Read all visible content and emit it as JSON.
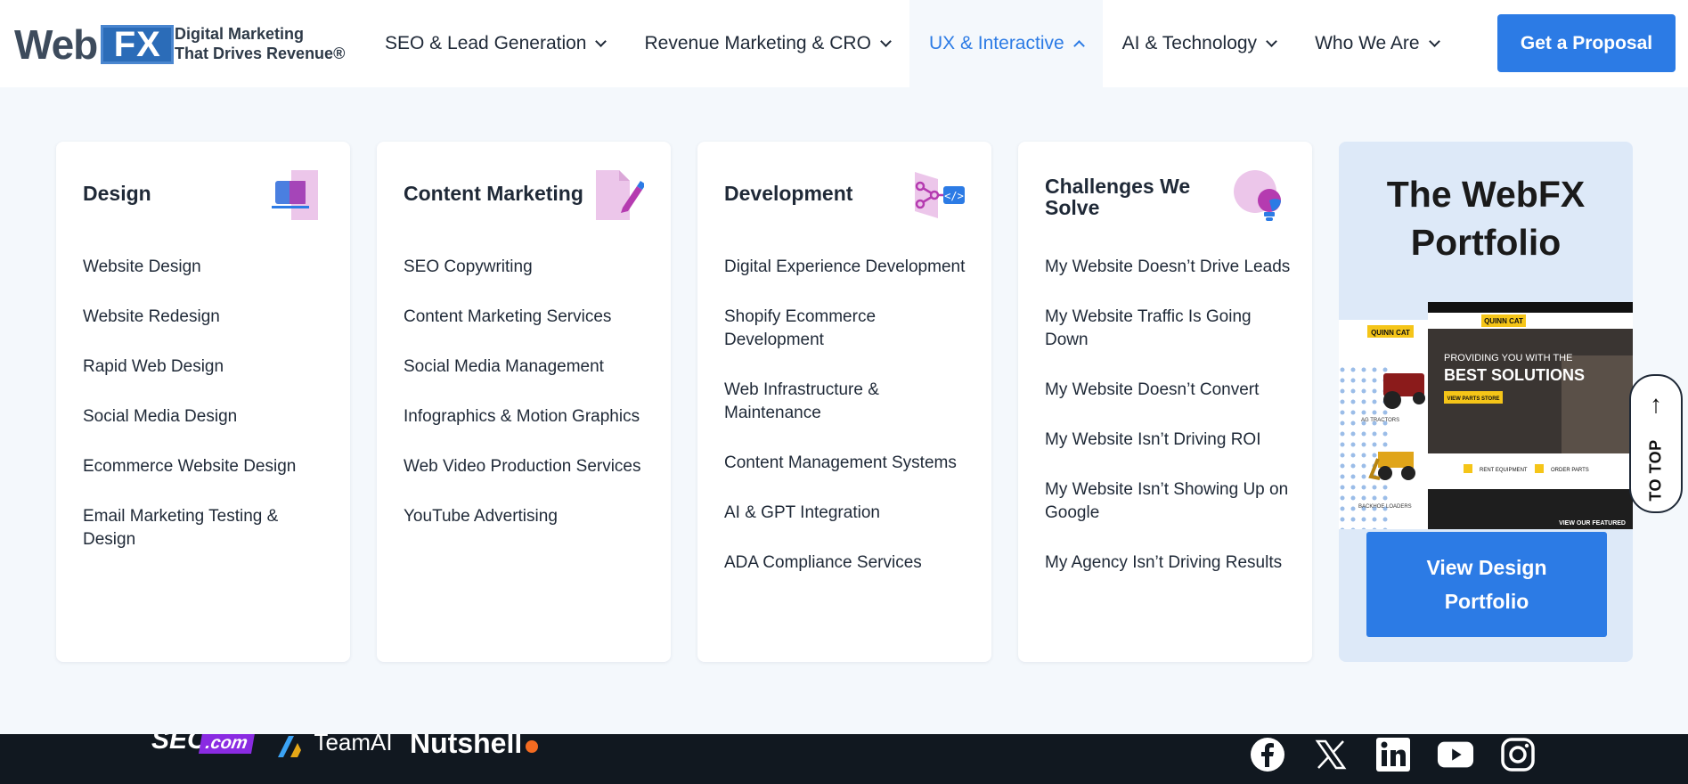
{
  "brand": {
    "logo_web": "Web",
    "logo_fx": "FX",
    "tagline_line1": "Digital Marketing",
    "tagline_line2": "That Drives Revenue®"
  },
  "nav": {
    "items": [
      {
        "label": "SEO & Lead Generation",
        "active": false
      },
      {
        "label": "Revenue Marketing & CRO",
        "active": false
      },
      {
        "label": "UX & Interactive",
        "active": true
      },
      {
        "label": "AI & Technology",
        "active": false
      },
      {
        "label": "Who We Are",
        "active": false
      }
    ],
    "cta_label": "Get a Proposal"
  },
  "menu": {
    "columns": [
      {
        "title": "Design",
        "icon": "laptop-icon",
        "links": [
          "Website Design",
          "Website Redesign",
          "Rapid Web Design",
          "Social Media Design",
          "Ecommerce Website Design",
          "Email Marketing Testing & Design"
        ]
      },
      {
        "title": "Content Marketing",
        "icon": "document-pen-icon",
        "links": [
          "SEO Copywriting",
          "Content Marketing Services",
          "Social Media Management",
          "Infographics & Motion Graphics",
          "Web Video Production Services",
          "YouTube Advertising"
        ]
      },
      {
        "title": "Development",
        "icon": "code-network-icon",
        "links": [
          "Digital Experience Development",
          "Shopify Ecommerce Development",
          "Web Infrastructure & Maintenance",
          "Content Management Systems",
          "AI & GPT Integration",
          "ADA Compliance Services"
        ]
      },
      {
        "title": "Challenges We Solve",
        "icon": "lightbulb-icon",
        "links": [
          "My Website Doesn’t Drive Leads",
          "My Website Traffic Is Going Down",
          "My Website Doesn’t Convert",
          "My Website Isn’t Driving ROI",
          "My Website Isn’t Showing Up on Google",
          "My Agency Isn’t Driving Results"
        ]
      }
    ],
    "portfolio": {
      "title_line1": "The WebFX",
      "title_line2": "Portfolio",
      "button_line1": "View Design",
      "button_line2": "Portfolio",
      "mock": {
        "brand": "QUINN CAT",
        "headline_line1": "PROVIDING YOU WITH THE",
        "headline_line2": "BEST SOLUTIONS",
        "cta": "VIEW PARTS STORE",
        "feature1": "RENT EQUIPMENT",
        "feature2": "ORDER PARTS",
        "footer_text": "VIEW OUR FEATURED",
        "label_tractor": "AG TRACTORS",
        "label_loader": "BACKHOE LOADERS"
      }
    }
  },
  "to_top": {
    "label": "TO TOP"
  },
  "footer": {
    "partners": [
      "SEO",
      ".com",
      "TeamAI",
      "Nutshell"
    ],
    "social_icons": [
      "facebook-icon",
      "x-icon",
      "linkedin-icon",
      "youtube-icon",
      "instagram-icon"
    ]
  },
  "colors": {
    "accent": "#2c7be5",
    "icon_purple": "#b53bb0",
    "icon_pink": "#e9c9e8",
    "footer_bg": "#111820"
  }
}
